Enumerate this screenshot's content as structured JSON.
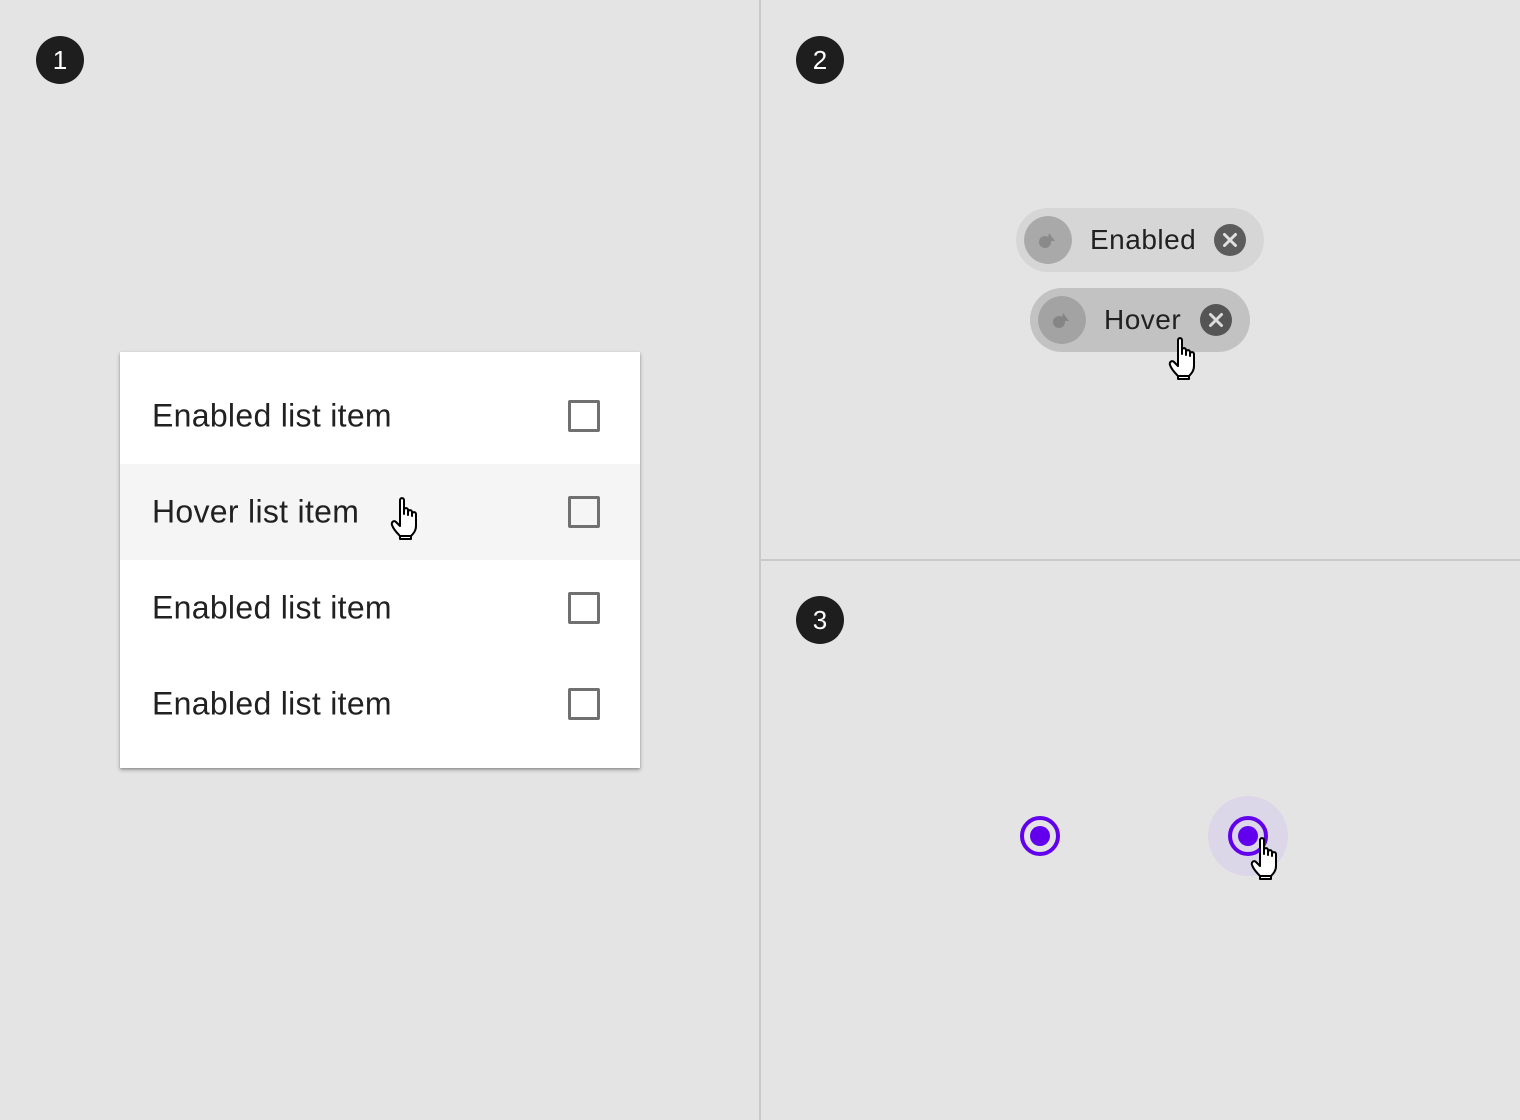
{
  "badges": [
    "1",
    "2",
    "3"
  ],
  "list": {
    "items": [
      {
        "label": "Enabled list item",
        "state": "enabled",
        "checked": false
      },
      {
        "label": "Hover list item",
        "state": "hover",
        "checked": false
      },
      {
        "label": "Enabled list item",
        "state": "enabled",
        "checked": false
      },
      {
        "label": "Enabled list item",
        "state": "enabled",
        "checked": false
      }
    ]
  },
  "chips": [
    {
      "label": "Enabled",
      "state": "enabled",
      "icon": "avatar-shapes-icon",
      "trailing_icon": "cancel-circle-icon"
    },
    {
      "label": "Hover",
      "state": "hover",
      "icon": "avatar-shapes-icon",
      "trailing_icon": "cancel-circle-icon"
    }
  ],
  "radios": [
    {
      "state": "enabled",
      "selected": true
    },
    {
      "state": "hover",
      "selected": true
    }
  ],
  "colors": {
    "background": "#e4e4e4",
    "badge": "#1e1e1e",
    "radio_accent": "#6200ee",
    "hover_halo": "#dcd6e9",
    "chip_enabled": "#d6d6d6",
    "chip_hover": "#c2c2c2"
  }
}
